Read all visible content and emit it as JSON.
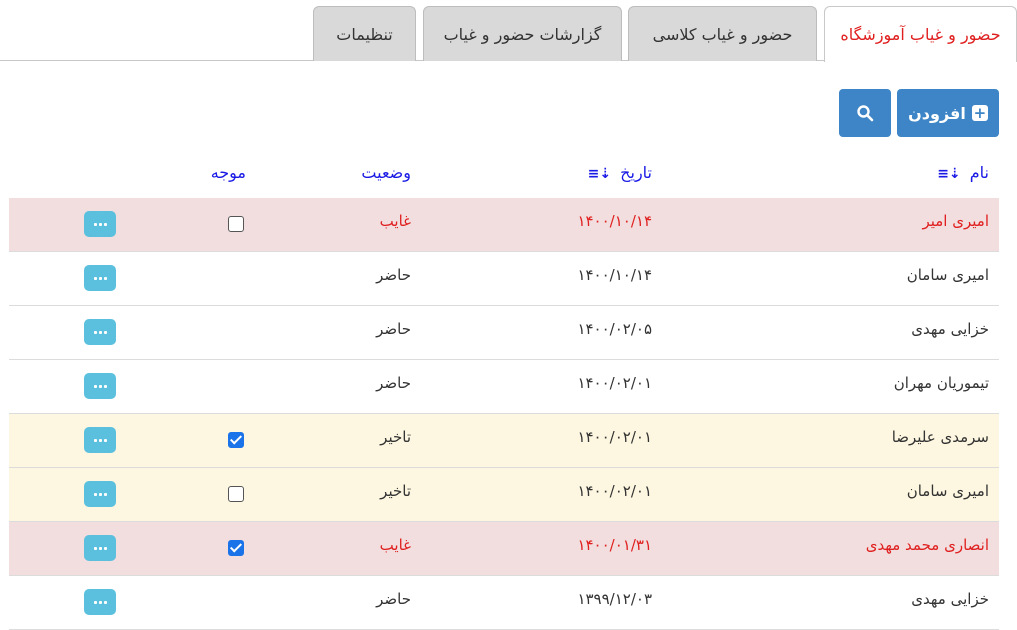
{
  "tabs": [
    {
      "label": "حضور و غیاب آموزشگاه",
      "active": true
    },
    {
      "label": "حضور و غیاب کلاسی",
      "active": false
    },
    {
      "label": "گزارشات حضور و غیاب",
      "active": false
    },
    {
      "label": "تنظیمات",
      "active": false
    }
  ],
  "toolbar": {
    "add_label": "افزودن",
    "add_icon": "plus-square-icon",
    "search_icon": "search-icon"
  },
  "table": {
    "columns": {
      "name": "نام",
      "date": "تاریخ",
      "status": "وضعیت",
      "excused": "موجه"
    },
    "sort_icon": "sort-icon",
    "rows": [
      {
        "name": "امیری امیر",
        "date": "۱۴۰۰/۱۰/۱۴",
        "status": "غایب",
        "type": "absent",
        "checkbox": "unchecked"
      },
      {
        "name": "امیری سامان",
        "date": "۱۴۰۰/۱۰/۱۴",
        "status": "حاضر",
        "type": "present",
        "checkbox": "none"
      },
      {
        "name": "خزایی مهدی",
        "date": "۱۴۰۰/۰۲/۰۵",
        "status": "حاضر",
        "type": "present",
        "checkbox": "none"
      },
      {
        "name": "تیموریان مهران",
        "date": "۱۴۰۰/۰۲/۰۱",
        "status": "حاضر",
        "type": "present",
        "checkbox": "none"
      },
      {
        "name": "سرمدی علیرضا",
        "date": "۱۴۰۰/۰۲/۰۱",
        "status": "تاخیر",
        "type": "late",
        "checkbox": "checked"
      },
      {
        "name": "امیری سامان",
        "date": "۱۴۰۰/۰۲/۰۱",
        "status": "تاخیر",
        "type": "late",
        "checkbox": "unchecked"
      },
      {
        "name": "انصاری محمد مهدی",
        "date": "۱۴۰۰/۰۱/۳۱",
        "status": "غایب",
        "type": "absent",
        "checkbox": "checked"
      },
      {
        "name": "خزایی مهدی",
        "date": "۱۳۹۹/۱۲/۰۳",
        "status": "حاضر",
        "type": "present",
        "checkbox": "none"
      }
    ]
  },
  "colors": {
    "accent": "#3d85c6",
    "active_tab_text": "#e02020",
    "header_text": "#1a1ae6",
    "absent_row": "#f2dede",
    "late_row": "#fdf7e1",
    "action_button": "#5bc0de"
  }
}
